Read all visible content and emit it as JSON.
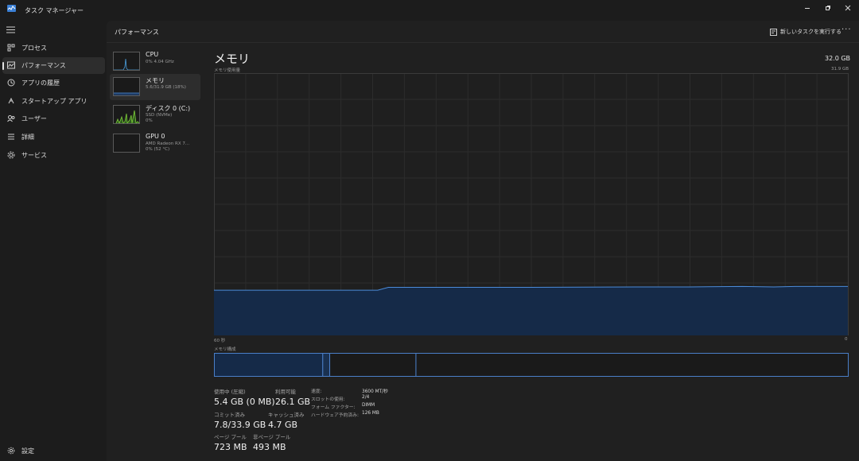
{
  "window": {
    "title": "タスク マネージャー",
    "minimize_icon": "minimize-icon",
    "restore_icon": "restore-icon",
    "close_icon": "close-icon"
  },
  "nav": {
    "items": [
      {
        "label": "プロセス",
        "icon": "processes-icon",
        "active": false
      },
      {
        "label": "パフォーマンス",
        "icon": "performance-icon",
        "active": true
      },
      {
        "label": "アプリの履歴",
        "icon": "app-history-icon",
        "active": false
      },
      {
        "label": "スタートアップ アプリ",
        "icon": "startup-icon",
        "active": false
      },
      {
        "label": "ユーザー",
        "icon": "users-icon",
        "active": false
      },
      {
        "label": "詳細",
        "icon": "details-icon",
        "active": false
      },
      {
        "label": "サービス",
        "icon": "services-icon",
        "active": false
      }
    ],
    "settings": "設定"
  },
  "header": {
    "title": "パフォーマンス",
    "run_task": "新しいタスクを実行する",
    "more": "···"
  },
  "devices": [
    {
      "name": "CPU",
      "line1": "0% 4.04 GHz",
      "line2": "",
      "active": false
    },
    {
      "name": "メモリ",
      "line1": "5.6/31.9 GB (18%)",
      "line2": "",
      "active": true
    },
    {
      "name": "ディスク 0 (C:)",
      "line1": "SSD (NVMe)",
      "line2": "0%",
      "active": false
    },
    {
      "name": "GPU 0",
      "line1": "AMD Radeon RX 7...",
      "line2": "0% (52 °C)",
      "active": false
    }
  ],
  "memory": {
    "title": "メモリ",
    "total": "32.0 GB",
    "graph_label": "メモリ使用量",
    "graph_max": "31.9 GB",
    "axis_left": "60 秒",
    "axis_right": "0",
    "composition_label": "メモリ構成",
    "composition": [
      0.171,
      0.011,
      0.136,
      0.682
    ]
  },
  "stats": {
    "in_use": {
      "label": "使用中 (圧縮)",
      "value": "5.4 GB (0 MB)"
    },
    "available": {
      "label": "利用可能",
      "value": "26.1 GB"
    },
    "committed": {
      "label": "コミット済み",
      "value": "7.8/33.9 GB"
    },
    "cached": {
      "label": "キャッシュ済み",
      "value": "4.7 GB"
    },
    "paged_pool": {
      "label": "ページ プール",
      "value": "723 MB"
    },
    "nonpaged_pool": {
      "label": "非ページ プール",
      "value": "493 MB"
    }
  },
  "specs": [
    {
      "label": "速度:",
      "value": "3600 MT/秒"
    },
    {
      "label": "スロットの使用:",
      "value": "2/4"
    },
    {
      "label": "フォーム ファクター:",
      "value": "DIMM"
    },
    {
      "label": "ハードウェア予約済み:",
      "value": "126 MB"
    }
  ],
  "chart_data": {
    "type": "area",
    "title": "メモリ使用量",
    "xlabel": "",
    "ylabel": "",
    "x_unit_left": "60 秒",
    "ylim": [
      0,
      31.9
    ],
    "x": [
      60,
      44.5,
      43.5,
      40,
      30,
      20,
      15,
      10,
      7,
      5,
      0
    ],
    "values": [
      5.5,
      5.5,
      5.85,
      5.85,
      5.85,
      5.9,
      5.9,
      5.95,
      5.9,
      5.95,
      5.95
    ],
    "grid": true,
    "colors": {
      "line": "#4a8ad8",
      "fill": "#152a48",
      "grid": "#2c2c2c",
      "border": "#3a3a3a"
    }
  }
}
